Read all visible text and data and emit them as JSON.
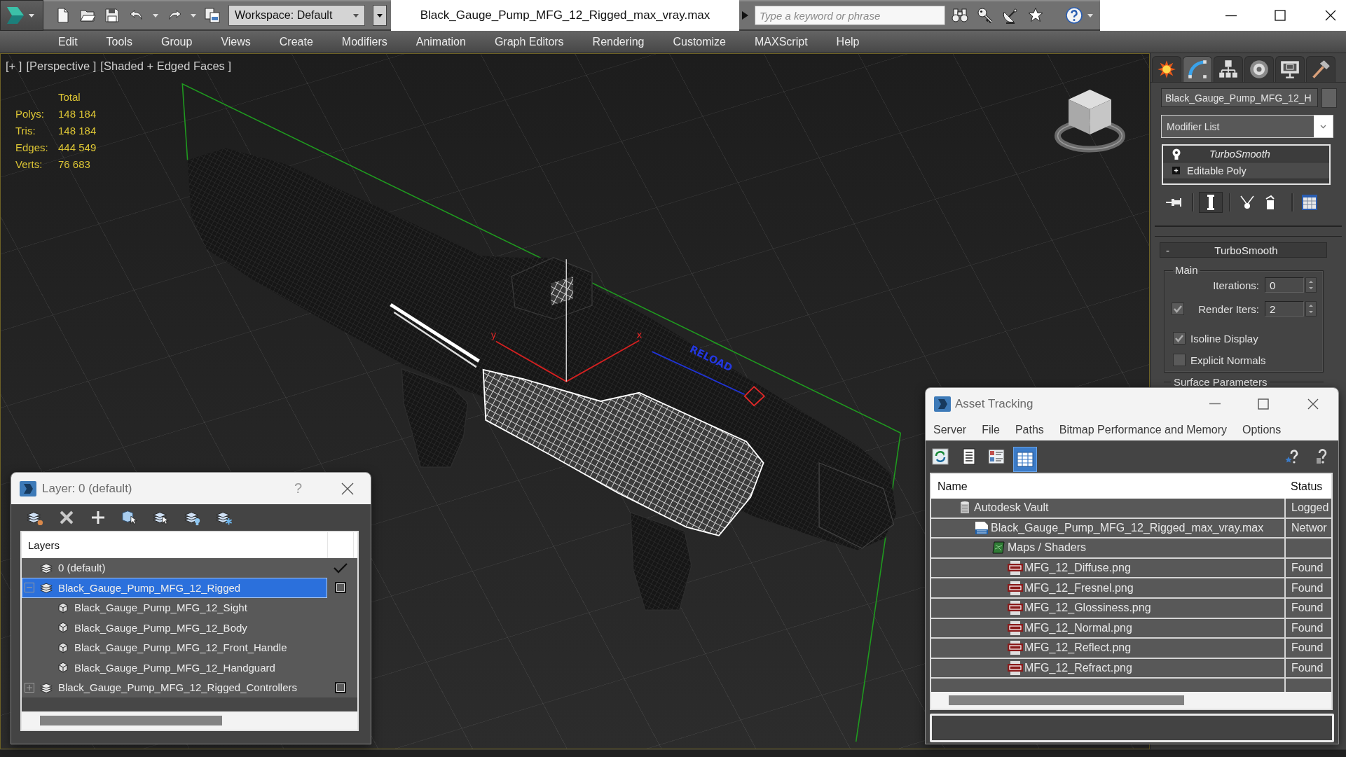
{
  "title_bar": {
    "workspace": "Workspace: Default",
    "title": "Black_Gauge_Pump_MFG_12_Rigged_max_vray.max",
    "search": {
      "placeholder": "Type a keyword or phrase"
    }
  },
  "menu": [
    "Edit",
    "Tools",
    "Group",
    "Views",
    "Create",
    "Modifiers",
    "Animation",
    "Graph Editors",
    "Rendering",
    "Customize",
    "MAXScript",
    "Help"
  ],
  "viewport": {
    "labels": [
      "[+ ]",
      "[Perspective ]",
      "[Shaded + Edged Faces ]"
    ],
    "stats": {
      "heading": "Total",
      "rows": [
        {
          "label": "Polys:",
          "value": "148 184"
        },
        {
          "label": "Tris:",
          "value": "148 184"
        },
        {
          "label": "Edges:",
          "value": "444 549"
        },
        {
          "label": "Verts:",
          "value": "76 683"
        }
      ]
    },
    "gizmo_axes": [
      "y",
      "x"
    ],
    "scene_text": "RELOAD"
  },
  "command_panel": {
    "tabs": [
      {
        "kind": "create",
        "selected": false
      },
      {
        "kind": "modify",
        "selected": true
      },
      {
        "kind": "hierarchy",
        "selected": false
      },
      {
        "kind": "motion",
        "selected": false
      },
      {
        "kind": "display",
        "selected": false
      },
      {
        "kind": "utilities",
        "selected": false
      }
    ],
    "object_name": "Black_Gauge_Pump_MFG_12_H",
    "modifier_list": "Modifier List",
    "stack": [
      {
        "kind": "modifier",
        "label": "TurboSmooth"
      },
      {
        "kind": "object",
        "label": "Editable Poly"
      }
    ],
    "rollout": {
      "sign": "-",
      "title": "TurboSmooth",
      "group": "Main",
      "spinners": [
        {
          "label": "Iterations:",
          "value": "0"
        },
        {
          "label": "Render Iters:",
          "value": "2",
          "checked": true
        }
      ],
      "options": [
        {
          "label": "Isoline Display",
          "checked": true
        },
        {
          "label": "Explicit Normals",
          "checked": false
        }
      ],
      "next_group": "Surface Parameters"
    }
  },
  "layer_dialog": {
    "title": "Layer: 0 (default)",
    "help": "?",
    "header": "Layers",
    "layers": [
      {
        "name": "0 (default)",
        "selected": false,
        "current": true
      },
      {
        "name": "Black_Gauge_Pump_MFG_12_Rigged",
        "selected": true,
        "current": false,
        "expanded": true,
        "children": [
          {
            "name": "Black_Gauge_Pump_MFG_12_Sight",
            "selected": false
          },
          {
            "name": "Black_Gauge_Pump_MFG_12_Body",
            "selected": false
          },
          {
            "name": "Black_Gauge_Pump_MFG_12_Front_Handle",
            "selected": false
          },
          {
            "name": "Black_Gauge_Pump_MFG_12_Handguard",
            "selected": false
          }
        ]
      },
      {
        "name": "Black_Gauge_Pump_MFG_12_Rigged_Controllers",
        "selected": false,
        "current": false,
        "expanded": false
      }
    ]
  },
  "asset_dialog": {
    "title": "Asset Tracking",
    "menu": [
      "Server",
      "File",
      "Paths",
      "Bitmap Performance and Memory",
      "Options"
    ],
    "tools": [
      {
        "kind": "refresh",
        "selected": false
      },
      {
        "kind": "list",
        "selected": false
      },
      {
        "kind": "thumbnails",
        "selected": false
      },
      {
        "kind": "table",
        "selected": true
      }
    ],
    "columns": [
      "Name",
      "Status"
    ],
    "rows": [
      {
        "kind": "vault",
        "name": "Autodesk Vault",
        "status": "Logged",
        "children": [
          {
            "kind": "scene",
            "name": "Black_Gauge_Pump_MFG_12_Rigged_max_vray.max",
            "status": "Networ",
            "children": [
              {
                "kind": "folder",
                "name": "Maps / Shaders",
                "children": [
                  {
                    "kind": "image",
                    "name": "MFG_12_Diffuse.png",
                    "status": "Found"
                  },
                  {
                    "kind": "image",
                    "name": "MFG_12_Fresnel.png",
                    "status": "Found"
                  },
                  {
                    "kind": "image",
                    "name": "MFG_12_Glossiness.png",
                    "status": "Found"
                  },
                  {
                    "kind": "image",
                    "name": "MFG_12_Normal.png",
                    "status": "Found"
                  },
                  {
                    "kind": "image",
                    "name": "MFG_12_Reflect.png",
                    "status": "Found"
                  },
                  {
                    "kind": "image",
                    "name": "MFG_12_Refract.png",
                    "status": "Found"
                  }
                ]
              }
            ]
          }
        ]
      }
    ]
  }
}
